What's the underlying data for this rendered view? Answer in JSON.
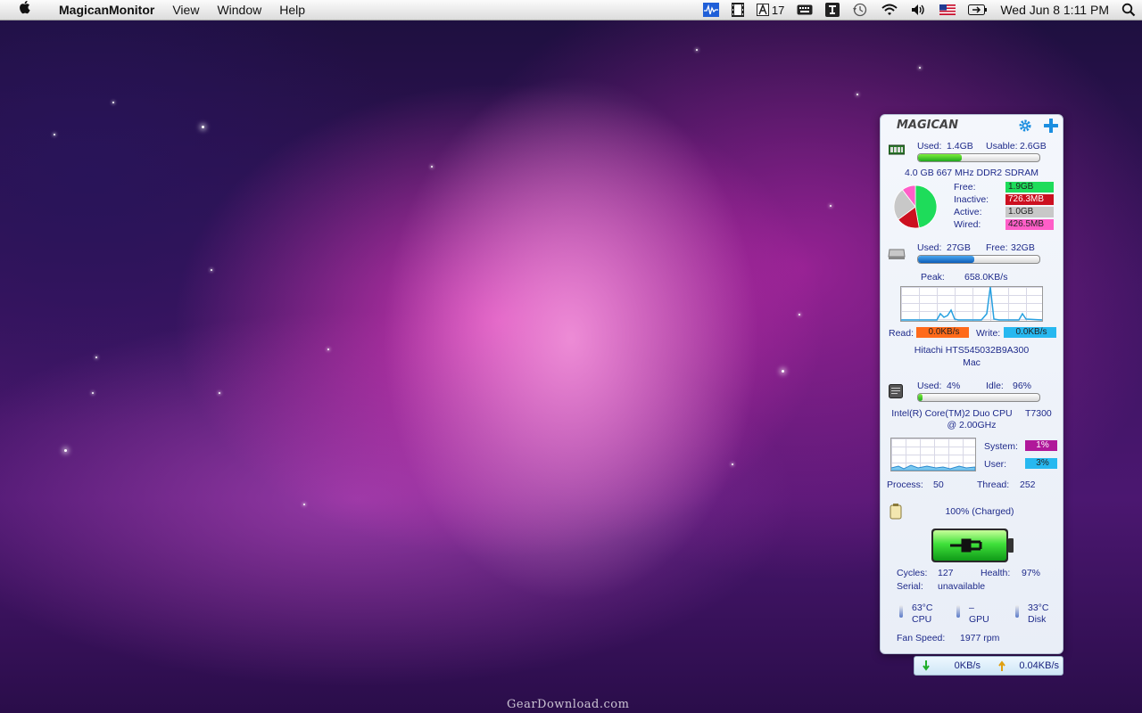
{
  "menubar": {
    "app_name": "MagicanMonitor",
    "menus": [
      "View",
      "Window",
      "Help"
    ],
    "status": {
      "calendar_count": "17",
      "clock": "Wed Jun 8  1:11 PM"
    }
  },
  "widget": {
    "brand": "MAGICAN",
    "memory": {
      "used_label": "Used:",
      "used_value": "1.4GB",
      "usable_label": "Usable:",
      "usable_value": "2.6GB",
      "used_fraction": 0.36,
      "ram_info": "4.0 GB 667 MHz DDR2 SDRAM",
      "breakdown": [
        {
          "label": "Free:",
          "value": "1.9GB",
          "color": "#1edc5a"
        },
        {
          "label": "Inactive:",
          "value": "726.3MB",
          "color": "#cc1020"
        },
        {
          "label": "Active:",
          "value": "1.0GB",
          "color": "#c8c8c8"
        },
        {
          "label": "Wired:",
          "value": "426.5MB",
          "color": "#ff5ec8"
        }
      ]
    },
    "disk": {
      "used_label": "Used:",
      "used_value": "27GB",
      "free_label": "Free:",
      "free_value": "32GB",
      "used_fraction": 0.46,
      "peak_label": "Peak:",
      "peak_value": "658.0KB/s",
      "read_label": "Read:",
      "read_value": "0.0KB/s",
      "write_label": "Write:",
      "write_value": "0.0KB/s",
      "read_color": "#ff6a1a",
      "write_color": "#27b8f0",
      "model": "Hitachi HTS545032B9A300",
      "host": "Mac"
    },
    "cpu": {
      "used_label": "Used:",
      "used_value": "4%",
      "idle_label": "Idle:",
      "idle_value": "96%",
      "used_fraction": 0.04,
      "model_line1": "Intel(R) Core(TM)2 Duo CPU     T7300",
      "model_line2": "@ 2.00GHz",
      "system_label": "System:",
      "system_value": "1%",
      "user_label": "User:",
      "user_value": "3%",
      "system_color": "#b0189a",
      "user_color": "#27b8f0",
      "process_label": "Process:",
      "process_value": "50",
      "thread_label": "Thread:",
      "thread_value": "252"
    },
    "battery": {
      "status": "100% (Charged)",
      "level_fraction": 1.0,
      "cycles_label": "Cycles:",
      "cycles_value": "127",
      "health_label": "Health:",
      "health_value": "97%",
      "serial_label": "Serial:",
      "serial_value": "unavailable"
    },
    "temps": {
      "cpu_value": "63°C",
      "cpu_label": "CPU",
      "gpu_value": "–",
      "gpu_label": "GPU",
      "disk_value": "33°C",
      "disk_label": "Disk",
      "fan_label": "Fan Speed:",
      "fan_value": "1977 rpm"
    }
  },
  "network": {
    "down_value": "0KB/s",
    "up_value": "0.04KB/s"
  },
  "watermark": "GearDownload.com"
}
